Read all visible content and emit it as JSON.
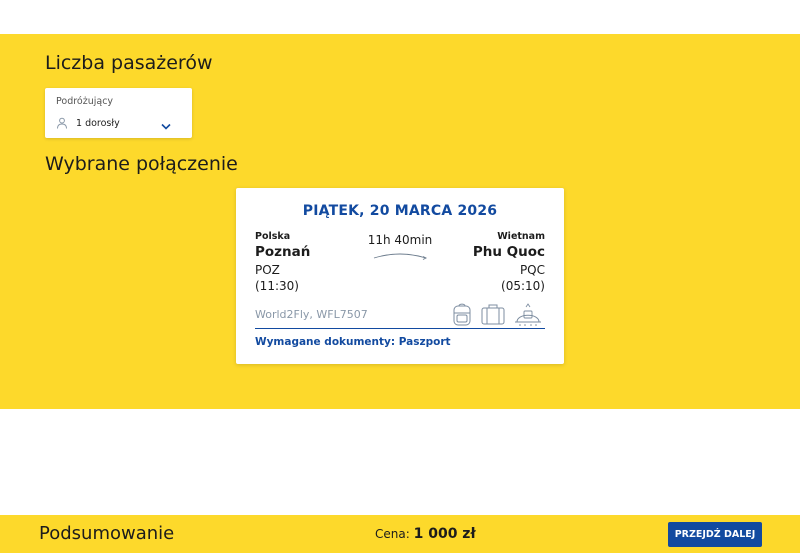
{
  "passengers": {
    "title": "Liczba pasażerów",
    "field_label": "Podróżujący",
    "value": "1 dorosły",
    "icon": "person-icon",
    "dropdown_icon": "chevron-down-icon"
  },
  "connection": {
    "title": "Wybrane połączenie",
    "date": "PIĄTEK, 20 MARCA 2026",
    "origin": {
      "country": "Polska",
      "city": "Poznań",
      "code": "POZ",
      "time": "(11:30)"
    },
    "destination": {
      "country": "Wietnam",
      "city": "Phu Quoc",
      "code": "PQC",
      "time": "(05:10)"
    },
    "duration": "11h 40min",
    "airline": "World2Fly, WFL7507",
    "baggage_icons": [
      "backpack-icon",
      "suitcase-icon",
      "checked-baggage-icon"
    ],
    "documents": "Wymagane dokumenty: Paszport"
  },
  "summary": {
    "title": "Podsumowanie",
    "price_label": "Cena:",
    "price_value": "1 000 zł",
    "next_button": "PRZEJDŹ DALEJ"
  },
  "colors": {
    "brand_yellow": "#fdd92b",
    "brand_blue": "#124aa0",
    "muted_text": "#8a98a8"
  }
}
